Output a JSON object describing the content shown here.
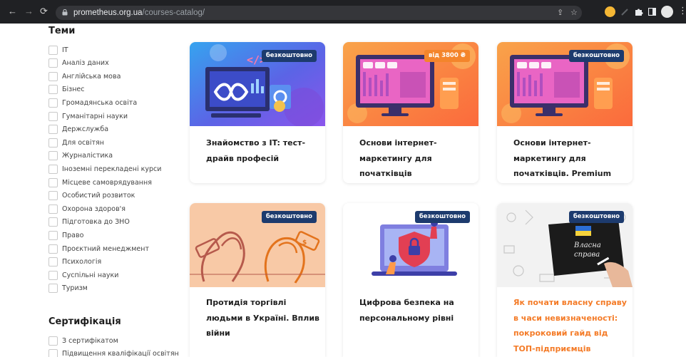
{
  "browser": {
    "url_host": "prometheus.org.ua",
    "url_path": "/courses-catalog/"
  },
  "sidebar": {
    "topics_title": "Теми",
    "topics": [
      "IT",
      "Аналіз даних",
      "Англійська мова",
      "Бізнес",
      "Громадянська освіта",
      "Гуманітарні науки",
      "Держслужба",
      "Для освітян",
      "Журналістика",
      "Іноземні перекладені курси",
      "Місцеве самоврядування",
      "Особистий розвиток",
      "Охорона здоров'я",
      "Підготовка до ЗНО",
      "Право",
      "Проєктний менеджмент",
      "Психологія",
      "Суспільні науки",
      "Туризм"
    ],
    "certification_title": "Сертифікація",
    "certification": [
      "З сертифікатом",
      "Підвищення кваліфікації освітян"
    ]
  },
  "courses": [
    {
      "badge": "безкоштовно",
      "badge_color": "#1d3b6e",
      "title": "Знайомство з IT: тест-драйв професій",
      "title_color": "#1e1e1e"
    },
    {
      "badge": "від 3800 ₴",
      "badge_color": "#f4852b",
      "title": "Основи інтернет-маркетингу для початківців",
      "title_color": "#1e1e1e"
    },
    {
      "badge": "безкоштовно",
      "badge_color": "#1d3b6e",
      "title": "Основи інтернет-маркетингу для початківців. Premium",
      "title_color": "#1e1e1e"
    },
    {
      "badge": "безкоштовно",
      "badge_color": "#1d3b6e",
      "title": "Протидія торгівлі людьми в Україні. Вплив війни",
      "title_color": "#1e1e1e"
    },
    {
      "badge": "безкоштовно",
      "badge_color": "#1d3b6e",
      "title": "Цифрова безпека на персональному рівні",
      "title_color": "#1e1e1e"
    },
    {
      "badge": "безкоштовно",
      "badge_color": "#1d3b6e",
      "title": "Як почати власну справу в часи невизначеності: покроковий гайд від ТОП-підприємців України",
      "title_color": "#f47b27",
      "image_text": "Власна справа"
    }
  ]
}
